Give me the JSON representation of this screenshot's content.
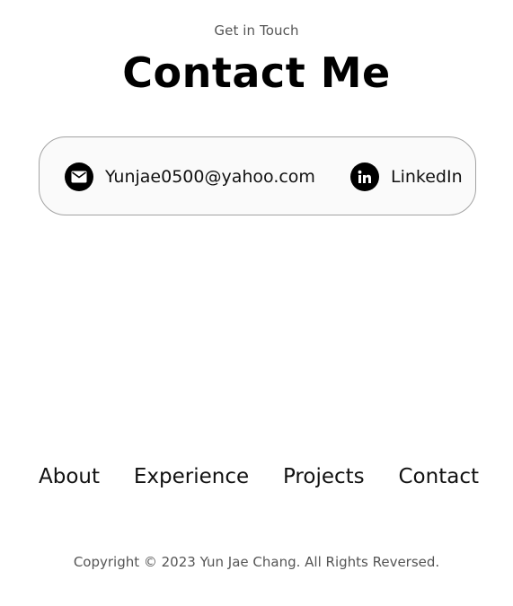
{
  "header": {
    "subtitle": "Get in Touch",
    "title": "Contact Me"
  },
  "contact": {
    "email": {
      "label": "Yunjae0500@yahoo.com",
      "icon": "email-icon"
    },
    "linkedin": {
      "label": "LinkedIn",
      "icon": "linkedin-icon"
    }
  },
  "nav": {
    "items": [
      {
        "label": "About"
      },
      {
        "label": "Experience"
      },
      {
        "label": "Projects"
      },
      {
        "label": "Contact"
      }
    ]
  },
  "footer": {
    "copyright": "Copyright © 2023 Yun Jae Chang. All Rights Reversed."
  },
  "colors": {
    "text": "#000000",
    "muted": "#555555",
    "box_border": "#a3a3a3",
    "box_background": "#fafafa"
  }
}
